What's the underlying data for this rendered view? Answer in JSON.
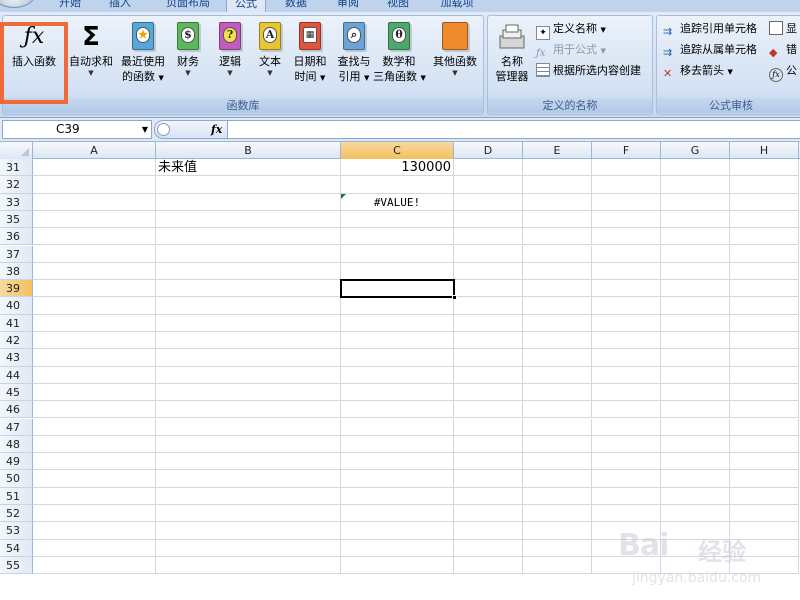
{
  "ribbon_tabs": [
    {
      "label": "开始",
      "active": false
    },
    {
      "label": "插入",
      "active": false
    },
    {
      "label": "页面布局",
      "active": false
    },
    {
      "label": "公式",
      "active": true
    },
    {
      "label": "数据",
      "active": false
    },
    {
      "label": "审阅",
      "active": false
    },
    {
      "label": "视图",
      "active": false
    },
    {
      "label": "加载项",
      "active": false
    }
  ],
  "function_library": {
    "title": "函数库",
    "insert_function": {
      "label": "插入函数",
      "icon": "fx-icon"
    },
    "autosum": {
      "label": "自动求和",
      "icon": "sigma-icon"
    },
    "recent": {
      "label1": "最近使用",
      "label2": "的函数",
      "icon": "star-book-icon"
    },
    "financial": {
      "label": "财务",
      "icon": "financial-book-icon"
    },
    "logical": {
      "label": "逻辑",
      "icon": "question-book-icon"
    },
    "text": {
      "label": "文本",
      "icon": "text-book-icon"
    },
    "datetime": {
      "label1": "日期和",
      "label2": "时间",
      "icon": "calendar-book-icon"
    },
    "lookup": {
      "label1": "查找与",
      "label2": "引用",
      "icon": "lookup-book-icon"
    },
    "math": {
      "label1": "数学和",
      "label2": "三角函数",
      "icon": "theta-book-icon"
    },
    "more": {
      "label": "其他函数",
      "icon": "more-books-icon"
    }
  },
  "defined_names": {
    "title": "定义的名称",
    "name_manager": {
      "label1": "名称",
      "label2": "管理器"
    },
    "define_name": "定义名称",
    "use_in_formula": "用于公式",
    "create_from_selection": "根据所选内容创建"
  },
  "formula_auditing": {
    "title": "公式审核",
    "trace_precedents": "追踪引用单元格",
    "trace_dependents": "追踪从属单元格",
    "remove_arrows": "移去箭头",
    "show_partial": "显",
    "error_partial": "错",
    "evaluate_partial": "公"
  },
  "formula_bar": {
    "name_box": "C39",
    "fx_label": "fx",
    "formula": ""
  },
  "grid": {
    "columns": [
      "A",
      "B",
      "C",
      "D",
      "E",
      "F",
      "G",
      "H"
    ],
    "selected_column": "C",
    "selected_row": "39",
    "rows": [
      "31",
      "32",
      "33",
      "35",
      "36",
      "37",
      "38",
      "39",
      "40",
      "41",
      "42",
      "43",
      "44",
      "45",
      "46",
      "47",
      "48",
      "49",
      "50",
      "51",
      "52",
      "53",
      "54",
      "55"
    ],
    "cells": {
      "B31": "未来值",
      "C31": "130000",
      "C33": "#VALUE!"
    }
  },
  "watermark": {
    "brand": "Bai",
    "brand2": "经验",
    "url": "jingyan.baidu.com"
  },
  "colors": {
    "highlight": "#ef6a3b",
    "selected_header": "#f1c15f",
    "error_triangle": "#1b7a2e"
  }
}
